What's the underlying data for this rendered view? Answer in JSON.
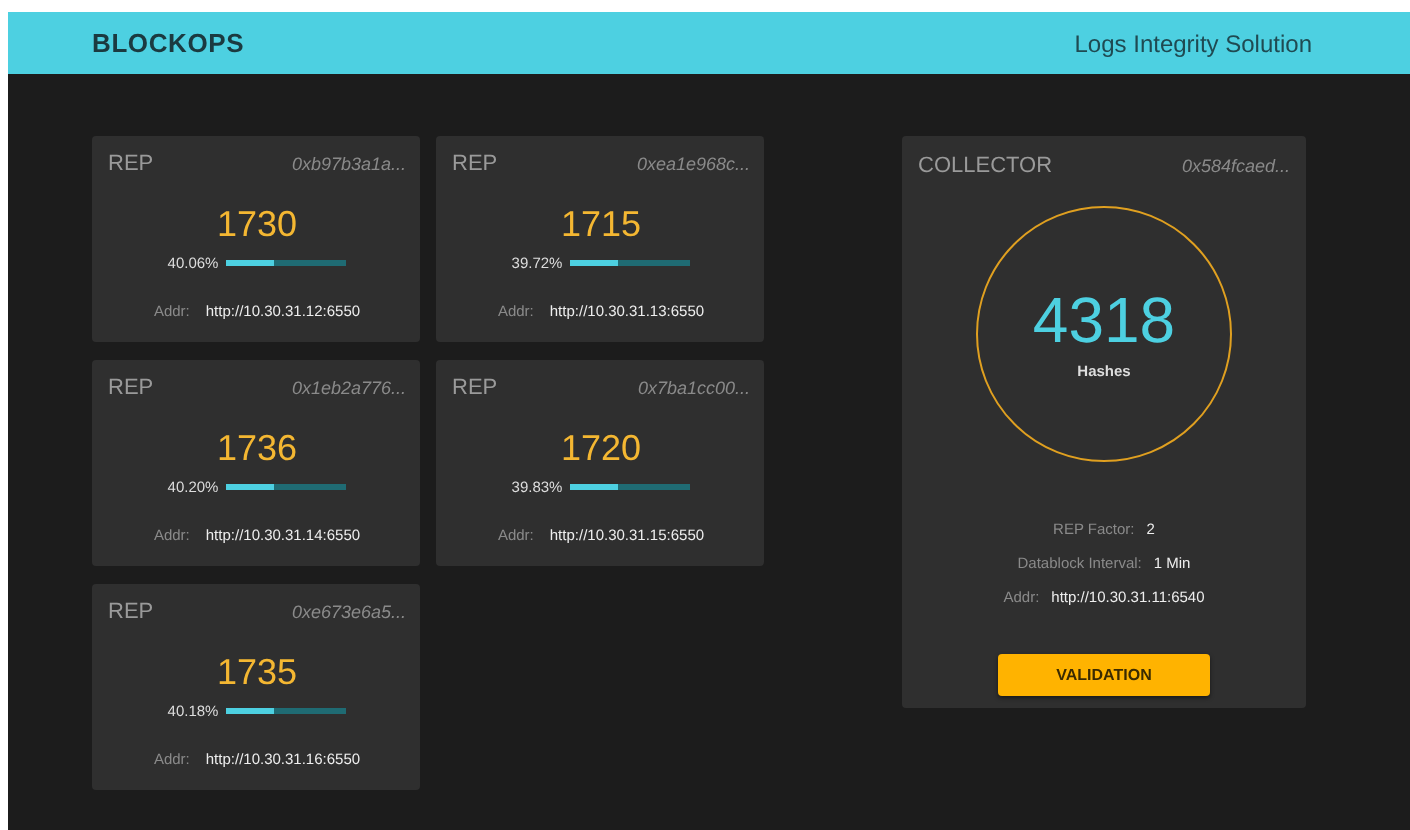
{
  "header": {
    "brand": "BLOCKOPS",
    "subtitle": "Logs Integrity Solution"
  },
  "reps": [
    {
      "title": "REP",
      "hash": "0xb97b3a1a...",
      "count": "1730",
      "percent": "40.06%",
      "level": 0.4006,
      "addr_label": "Addr:",
      "addr": "http://10.30.31.12:6550"
    },
    {
      "title": "REP",
      "hash": "0xea1e968c...",
      "count": "1715",
      "percent": "39.72%",
      "level": 0.3972,
      "addr_label": "Addr:",
      "addr": "http://10.30.31.13:6550"
    },
    {
      "title": "REP",
      "hash": "0x1eb2a776...",
      "count": "1736",
      "percent": "40.20%",
      "level": 0.402,
      "addr_label": "Addr:",
      "addr": "http://10.30.31.14:6550"
    },
    {
      "title": "REP",
      "hash": "0x7ba1cc00...",
      "count": "1720",
      "percent": "39.83%",
      "level": 0.3983,
      "addr_label": "Addr:",
      "addr": "http://10.30.31.15:6550"
    },
    {
      "title": "REP",
      "hash": "0xe673e6a5...",
      "count": "1735",
      "percent": "40.18%",
      "level": 0.4018,
      "addr_label": "Addr:",
      "addr": "http://10.30.31.16:6550"
    }
  ],
  "collector": {
    "title": "COLLECTOR",
    "hash": "0x584fcaed...",
    "total": "4318",
    "total_label": "Hashes",
    "details": [
      {
        "label": "REP Factor:",
        "value": "2"
      },
      {
        "label": "Datablock Interval:",
        "value": "1 Min"
      },
      {
        "label": "Addr:",
        "value": "http://10.30.31.11:6540"
      }
    ],
    "button": "VALIDATION"
  }
}
